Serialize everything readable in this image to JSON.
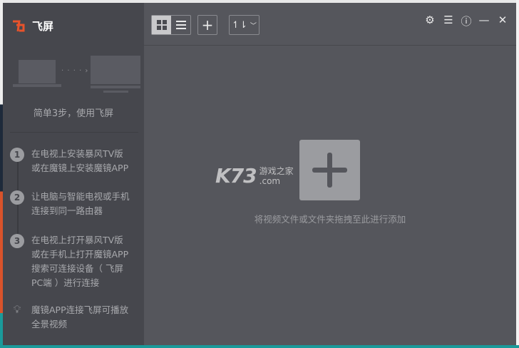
{
  "app": {
    "title": "飞屏",
    "brand_color": "#e8532b"
  },
  "sidebar": {
    "tagline": "简单3步，使用飞屏",
    "steps": [
      {
        "num": "1",
        "lines": [
          "在电视上安装暴风TV版",
          "或在魔镜上安装魔镜APP"
        ]
      },
      {
        "num": "2",
        "lines": [
          "让电脑与智能电视或手机",
          "连接到同一路由器"
        ]
      },
      {
        "num": "3",
        "lines": [
          "在电视上打开暴风TV版",
          "或在手机上打开魔镜APP",
          "搜索可连接设备（ 飞屏",
          "PC端 ）进行连接"
        ]
      }
    ],
    "tip": {
      "icon": "lightbulb-icon",
      "lines": [
        "魔镜APP连接飞屏可播放",
        "全景视频"
      ]
    }
  },
  "toolbar": {
    "view_mode": "grid",
    "add_label": "+",
    "sort_label": "↿⇂"
  },
  "window_controls": [
    "settings",
    "notes",
    "help",
    "minimize",
    "close"
  ],
  "main": {
    "hint": "将视频文件或文件夹拖拽至此进行添加"
  },
  "watermark": {
    "big": "K73",
    "small1": "游戏之家",
    "small2": ".com"
  }
}
